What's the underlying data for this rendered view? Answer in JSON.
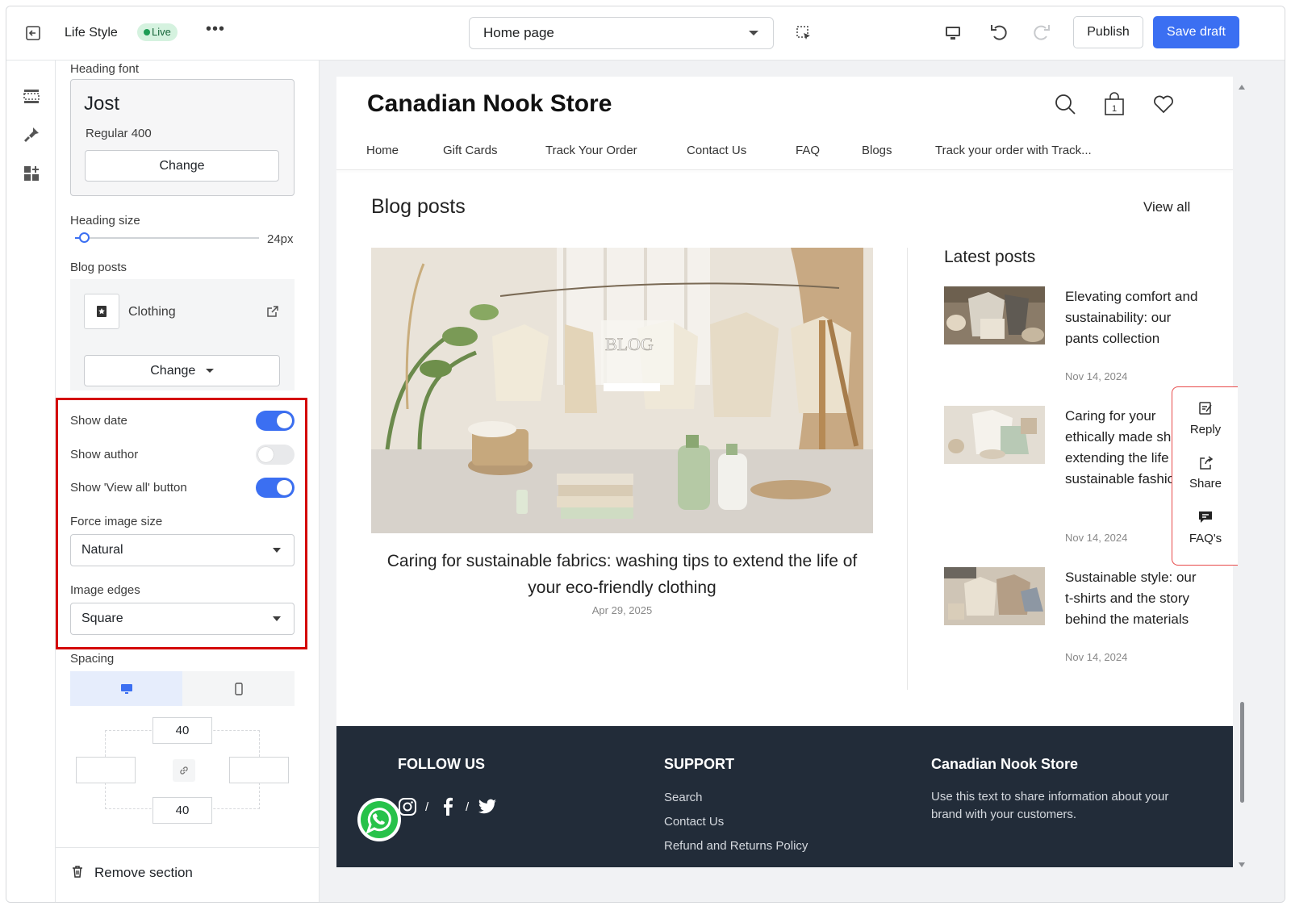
{
  "topbar": {
    "theme_name": "Life Style",
    "live_badge": "Live",
    "more": "•••",
    "page_select": "Home page",
    "publish_label": "Publish",
    "save_label": "Save draft"
  },
  "panel": {
    "heading_font_label": "Heading font",
    "font_name": "Jost",
    "font_weight": "Regular 400",
    "font_change": "Change",
    "heading_size_label": "Heading size",
    "heading_size_value": "24px",
    "heading_size_fraction": 0.05,
    "blog_posts_label": "Blog posts",
    "blog_name": "Clothing",
    "blog_change": "Change",
    "toggles": [
      {
        "label": "Show date",
        "on": true
      },
      {
        "label": "Show author",
        "on": false
      },
      {
        "label": "Show 'View all' button",
        "on": true
      }
    ],
    "force_image_label": "Force image size",
    "force_image_value": "Natural",
    "image_edges_label": "Image edges",
    "image_edges_value": "Square",
    "spacing_label": "Spacing",
    "spacing_top": "40",
    "spacing_bottom": "40",
    "remove_label": "Remove section"
  },
  "store": {
    "title": "Canadian Nook Store",
    "cart_count": "1",
    "nav": [
      "Home",
      "Gift Cards",
      "Track Your Order",
      "Contact Us",
      "FAQ",
      "Blogs",
      "Track your order with Track..."
    ],
    "section_title": "Blog posts",
    "view_all": "View all",
    "hero_image_text": "BLOG",
    "hero_caption": "Caring for sustainable fabrics: washing tips to extend the life of your eco-friendly clothing",
    "hero_date": "Apr 29, 2025",
    "latest_title": "Latest posts",
    "posts": [
      {
        "title": "Elevating comfort and sustainability: our pants collection",
        "date": "Nov 14, 2024"
      },
      {
        "title": "Caring for your ethically made shirts: extending the life of sustainable fashion",
        "date": "Nov 14, 2024"
      },
      {
        "title": "Sustainable style: our t-shirts and the story behind the materials",
        "date": "Nov 14, 2024"
      }
    ],
    "footer": {
      "follow": "FOLLOW US",
      "support": "SUPPORT",
      "support_links": [
        "Search",
        "Contact Us",
        "Refund and Returns Policy"
      ],
      "brand": "Canadian Nook Store",
      "brand_text": "Use this text to share information about your brand with your customers."
    },
    "widget": [
      "Reply",
      "Share",
      "FAQ's"
    ]
  },
  "colors": {
    "accent": "#3b6ff2",
    "live_bg": "#d5f2df",
    "footer_bg": "#222c39",
    "highlight": "#d40000"
  }
}
